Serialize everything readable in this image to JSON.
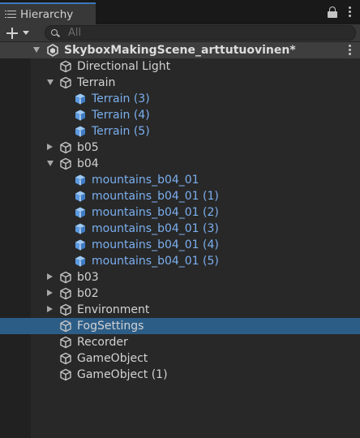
{
  "window": {
    "tab_label": "Hierarchy"
  },
  "toolbar": {
    "search_placeholder": "All"
  },
  "hierarchy": {
    "scene": {
      "label": "SkyboxMakingScene_arttutuovinen*"
    },
    "rows": [
      {
        "label": "Directional Light",
        "type": "object",
        "depth": 1,
        "fold": "none"
      },
      {
        "label": "Terrain",
        "type": "object",
        "depth": 1,
        "fold": "open"
      },
      {
        "label": "Terrain (3)",
        "type": "prefab",
        "depth": 2,
        "fold": "none"
      },
      {
        "label": "Terrain (4)",
        "type": "prefab",
        "depth": 2,
        "fold": "none"
      },
      {
        "label": "Terrain (5)",
        "type": "prefab",
        "depth": 2,
        "fold": "none"
      },
      {
        "label": "b05",
        "type": "object",
        "depth": 1,
        "fold": "closed"
      },
      {
        "label": "b04",
        "type": "object",
        "depth": 1,
        "fold": "open"
      },
      {
        "label": "mountains_b04_01",
        "type": "prefab",
        "depth": 2,
        "fold": "none"
      },
      {
        "label": "mountains_b04_01 (1)",
        "type": "prefab",
        "depth": 2,
        "fold": "none"
      },
      {
        "label": "mountains_b04_01 (2)",
        "type": "prefab",
        "depth": 2,
        "fold": "none"
      },
      {
        "label": "mountains_b04_01 (3)",
        "type": "prefab",
        "depth": 2,
        "fold": "none"
      },
      {
        "label": "mountains_b04_01 (4)",
        "type": "prefab",
        "depth": 2,
        "fold": "none"
      },
      {
        "label": "mountains_b04_01 (5)",
        "type": "prefab",
        "depth": 2,
        "fold": "none"
      },
      {
        "label": "b03",
        "type": "object",
        "depth": 1,
        "fold": "closed"
      },
      {
        "label": "b02",
        "type": "object",
        "depth": 1,
        "fold": "closed"
      },
      {
        "label": "Environment",
        "type": "object",
        "depth": 1,
        "fold": "closed"
      },
      {
        "label": "FogSettings",
        "type": "object",
        "depth": 1,
        "fold": "none",
        "selected": true
      },
      {
        "label": "Recorder",
        "type": "object",
        "depth": 1,
        "fold": "none"
      },
      {
        "label": "GameObject",
        "type": "object",
        "depth": 1,
        "fold": "none"
      },
      {
        "label": "GameObject (1)",
        "type": "object",
        "depth": 1,
        "fold": "none"
      }
    ]
  },
  "colors": {
    "selection": "#2c5d87",
    "prefab_text": "#7bafef",
    "tab_accent": "#3a79bb"
  }
}
